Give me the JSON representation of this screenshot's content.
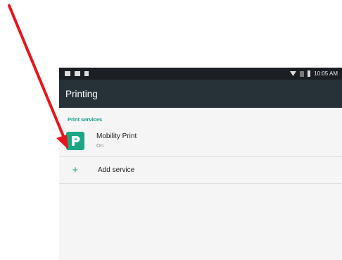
{
  "status_bar": {
    "time": "10:05 AM",
    "icons_left": [
      "gallery-icon",
      "video-icon",
      "flag-icon"
    ],
    "icons_right": [
      "wifi-icon",
      "signal-icon",
      "battery-icon"
    ]
  },
  "toolbar": {
    "title": "Printing"
  },
  "print_services": {
    "header": "Print services",
    "services": [
      {
        "name": "Mobility Print",
        "status": "On",
        "icon": "mobility-print-icon",
        "icon_color": "#1ba784"
      }
    ],
    "add_service": {
      "label": "Add service",
      "icon": "plus-icon"
    }
  },
  "annotation": {
    "icon": "red-arrow-icon",
    "color": "#e8141b"
  }
}
